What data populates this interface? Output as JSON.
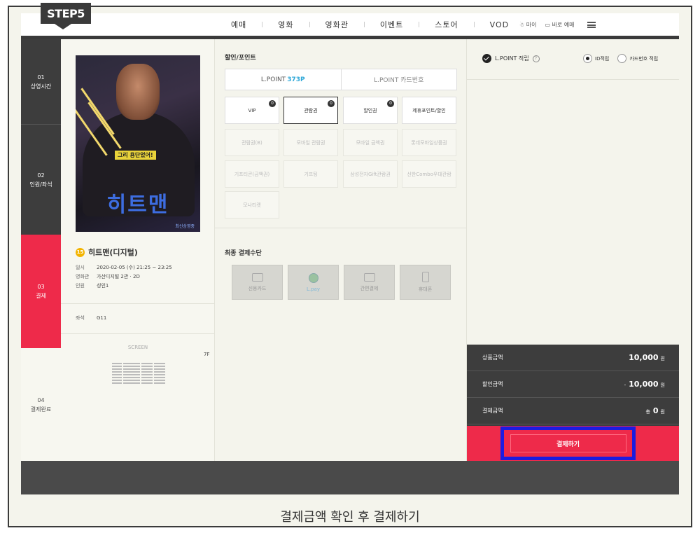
{
  "step_tag": "STEP5",
  "nav": {
    "menu": [
      "예매",
      "영화",
      "영화관",
      "이벤트",
      "스토어",
      "VOD"
    ],
    "util": [
      "마이",
      "바로 예매"
    ]
  },
  "steps": [
    {
      "num": "01",
      "label": "상영시간"
    },
    {
      "num": "02",
      "label": "인원/좌석"
    },
    {
      "num": "03",
      "label": "결제"
    },
    {
      "num": "04",
      "label": "결제완료"
    }
  ],
  "movie": {
    "poster_caption": "그리 용단었어!",
    "poster_logo": "히트맨",
    "poster_sub": "최신상영중",
    "age": "15",
    "title": "히트맨(디지털)",
    "info": [
      {
        "k": "일시",
        "v": "2020-02-05 (수) 21:25 ~ 23:25"
      },
      {
        "k": "영화관",
        "v": "가산디지털 2관 · 2D"
      },
      {
        "k": "인원",
        "v": "성인1"
      }
    ],
    "seat_label": "좌석",
    "seat_value": "G11",
    "screen": "SCREEN",
    "floor": "7F"
  },
  "discount": {
    "title": "할인/포인트",
    "lpoint_label": "L.POINT",
    "lpoint_value": "373P",
    "lpoint_card": "L.POINT 카드번호",
    "coupons": [
      {
        "label": "VIP",
        "badge": "0",
        "state": "normal"
      },
      {
        "label": "관람권",
        "badge": "0",
        "state": "selected"
      },
      {
        "label": "할인권",
        "badge": "0",
        "state": "normal"
      },
      {
        "label": "제휴포인트/할인",
        "badge": "",
        "state": "normal"
      },
      {
        "label": "관람권(B)",
        "badge": "",
        "state": "disabled"
      },
      {
        "label": "모바일 관람권",
        "badge": "",
        "state": "disabled"
      },
      {
        "label": "모바일 금액권",
        "badge": "",
        "state": "disabled"
      },
      {
        "label": "롯데모바일상품권",
        "badge": "",
        "state": "disabled"
      },
      {
        "label": "기프티콘(금액권)",
        "badge": "",
        "state": "disabled"
      },
      {
        "label": "기프팅",
        "badge": "",
        "state": "disabled"
      },
      {
        "label": "삼성전자Gift관람권",
        "badge": "",
        "state": "disabled"
      },
      {
        "label": "신한Combo우대관람",
        "badge": "",
        "state": "disabled"
      },
      {
        "label": "모나티켓",
        "badge": "",
        "state": "disabled"
      }
    ]
  },
  "payment": {
    "title": "최종 결제수단",
    "methods": [
      {
        "label": "신용카드",
        "icon": "card-icon"
      },
      {
        "label": "L.pay",
        "icon": "lpay-icon"
      },
      {
        "label": "간편결제",
        "icon": "easy-pay-icon"
      },
      {
        "label": "휴대폰",
        "icon": "phone-icon"
      }
    ]
  },
  "lpoint_save": {
    "checkbox": "L.POINT 적립",
    "radio_id": "ID적립",
    "radio_card": "카드번호 적립"
  },
  "summary": {
    "rows": [
      {
        "label": "상품금액",
        "prefix": "",
        "value": "10,000",
        "unit": "원"
      },
      {
        "label": "할인금액",
        "prefix": "-",
        "value": "10,000",
        "unit": "원"
      },
      {
        "label": "결제금액",
        "prefix": "총",
        "value": "0",
        "unit": "원"
      }
    ],
    "pay_button": "결제하기"
  },
  "caption": "결제금액 확인 후 결제하기",
  "colors": {
    "accent": "#ee2a4a",
    "dark": "#3d3d3d",
    "highlight_box": "#1c1ce0",
    "lpoint_blue": "#2fa8d8"
  }
}
